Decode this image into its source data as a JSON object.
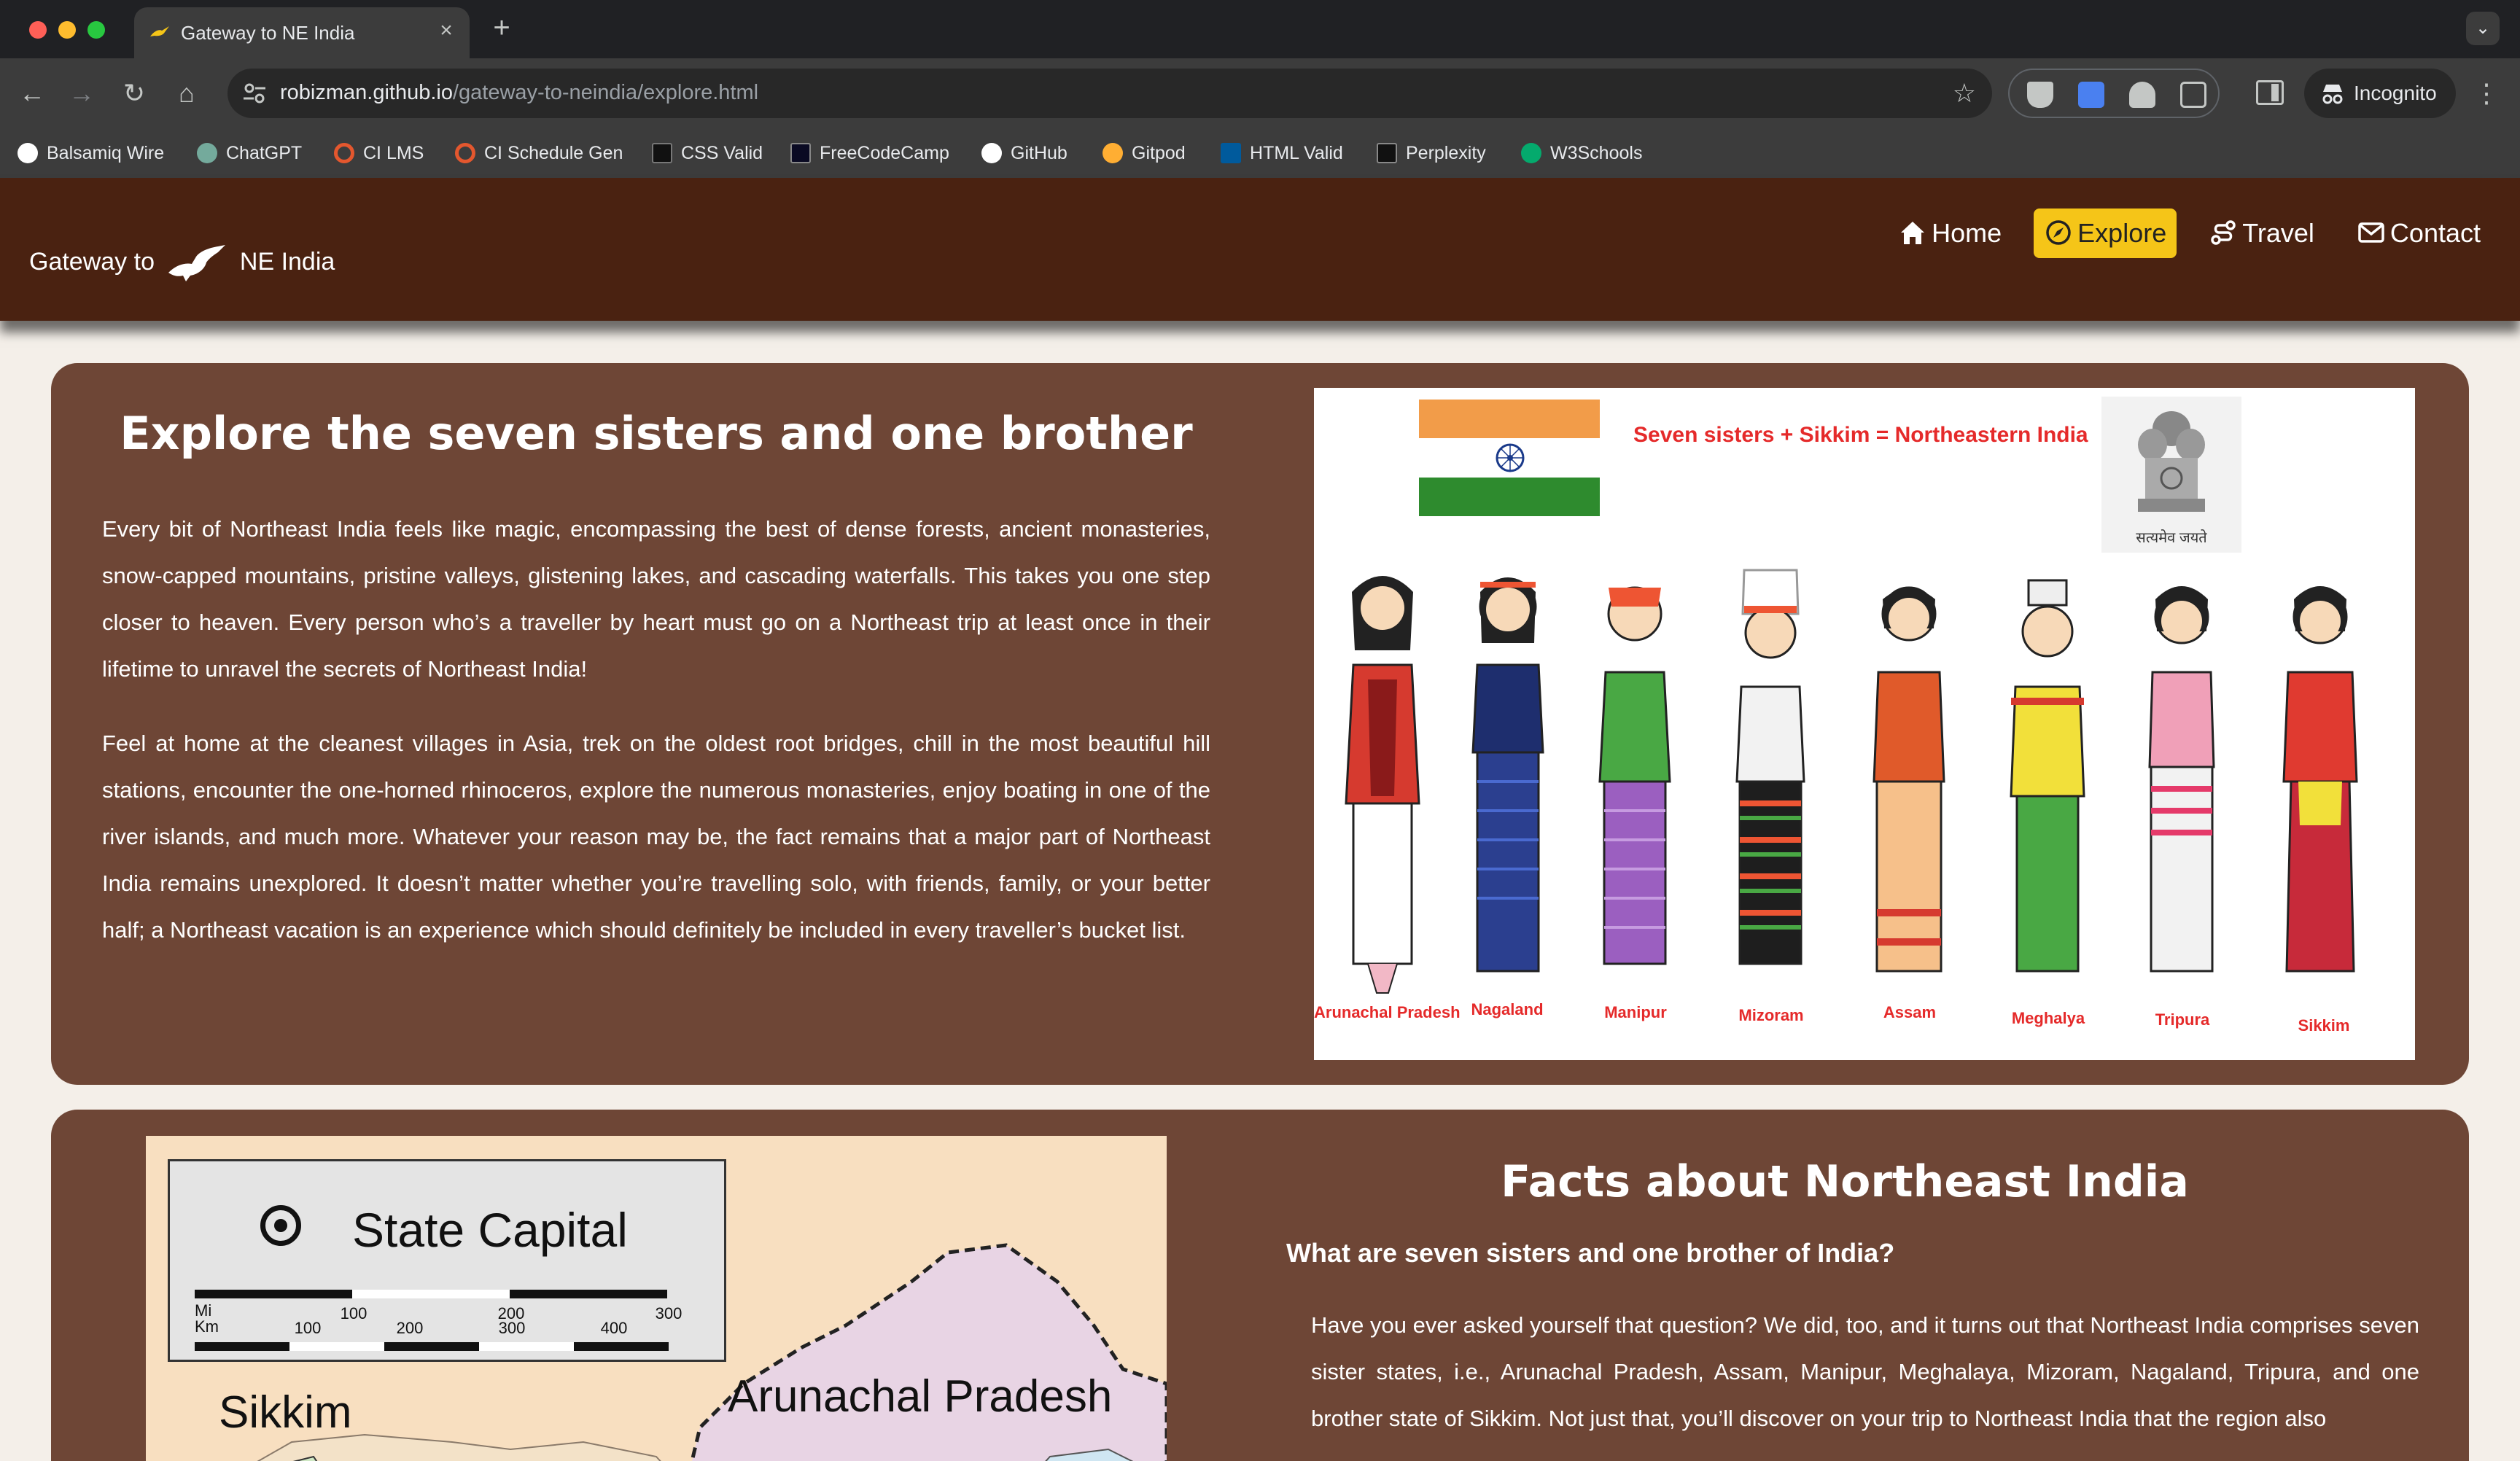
{
  "browser": {
    "tab_title": "Gateway to NE India",
    "url_host": "robizman.github.io",
    "url_path": "/gateway-to-neindia/explore.html",
    "profile_label": "Incognito",
    "bookmarks": [
      {
        "label": "Balsamiq Wire",
        "icon": "balsamiq-icon",
        "color": "#ffffff"
      },
      {
        "label": "ChatGPT",
        "icon": "chatgpt-icon",
        "color": "#74aa9c"
      },
      {
        "label": "CI LMS",
        "icon": "ci-icon",
        "color": "#e4572e"
      },
      {
        "label": "CI Schedule Gen",
        "icon": "ci-icon",
        "color": "#e4572e"
      },
      {
        "label": "CSS Valid",
        "icon": "css-icon",
        "color": "#111111"
      },
      {
        "label": "FreeCodeCamp",
        "icon": "freecodecamp-icon",
        "color": "#0a0a23"
      },
      {
        "label": "GitHub",
        "icon": "github-icon",
        "color": "#ffffff"
      },
      {
        "label": "Gitpod",
        "icon": "gitpod-icon",
        "color": "#ffae33"
      },
      {
        "label": "HTML Valid",
        "icon": "w3c-icon",
        "color": "#005a9c"
      },
      {
        "label": "Perplexity",
        "icon": "perplexity-icon",
        "color": "#111111"
      },
      {
        "label": "W3Schools",
        "icon": "w3schools-icon",
        "color": "#04aa6d"
      }
    ]
  },
  "site": {
    "brand_left": "Gateway to",
    "brand_right": "NE India",
    "nav": [
      {
        "label": "Home",
        "icon": "home-icon",
        "active": false
      },
      {
        "label": "Explore",
        "icon": "compass-icon",
        "active": true
      },
      {
        "label": "Travel",
        "icon": "route-icon",
        "active": false
      },
      {
        "label": "Contact",
        "icon": "envelope-icon",
        "active": false
      }
    ],
    "colors": {
      "header": "#4a2211",
      "card": "#6e4636",
      "accent": "#f5c518",
      "background": "#f4efe9"
    }
  },
  "explore": {
    "title": "Explore the seven sisters and one brother",
    "paragraphs": [
      "Every bit of Northeast India feels like magic, encompassing the best of dense forests, ancient monasteries, snow-capped mountains, pristine valleys, glistening lakes, and cascading waterfalls. This takes you one step closer to heaven. Every person who’s a traveller by heart must go on a Northeast trip at least once in their lifetime to unravel the secrets of Northeast India!",
      "Feel at home at the cleanest villages in Asia, trek on the oldest root bridges, chill in the most beautiful hill stations, encounter the one-horned rhinoceros, explore the numerous monasteries, enjoy boating in one of the river islands, and much more. Whatever your reason may be, the fact remains that a major part of Northeast India remains unexplored. It doesn’t matter whether you’re travelling solo, with friends, family, or your better half; a Northeast vacation is an experience which should definitely be included in every traveller’s bucket list."
    ],
    "illustration": {
      "title": "Seven sisters + Sikkim = Northeastern India",
      "emblem_motto": "सत्यमेव जयते",
      "states": [
        "Arunachal Pradesh",
        "Nagaland",
        "Manipur",
        "Mizoram",
        "Assam",
        "Meghalya",
        "Tripura",
        "Sikkim"
      ],
      "dress_colors": [
        "#d63a2f",
        "#2b3f8f",
        "#9b5fc0",
        "#1e1e1e",
        "#e05a2a",
        "#49a844",
        "#f2f2f2",
        "#c72a3a"
      ]
    }
  },
  "facts": {
    "title": "Facts about Northeast India",
    "question": "What are seven sisters and one brother of India?",
    "paragraph": "Have you ever asked yourself that question? We did, too, and it turns out that Northeast India comprises seven sister states, i.e., Arunachal Pradesh, Assam, Manipur, Meghalaya, Mizoram, Nagaland, Tripura, and one brother state of Sikkim. Not just that, you’ll discover on your trip to Northeast India that the region also",
    "map": {
      "legend": "State Capital",
      "scale_mi": [
        "100",
        "200",
        "300"
      ],
      "scale_km": [
        "100",
        "200",
        "300",
        "400"
      ],
      "unit_mi": "Mi",
      "unit_km": "Km",
      "labels": [
        "Sikkim",
        "Arunachal Pradesh"
      ]
    }
  }
}
